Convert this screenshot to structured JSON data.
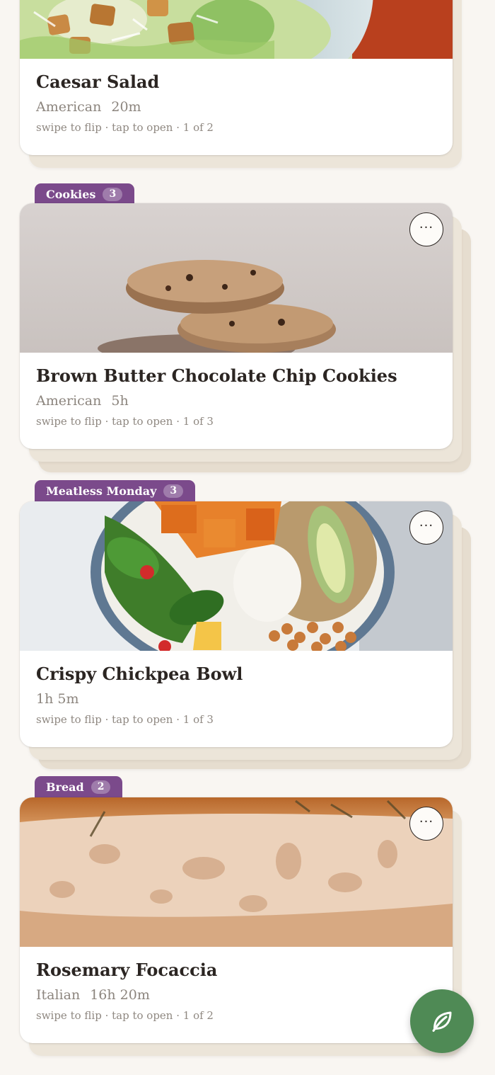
{
  "cards": [
    {
      "title": "Caesar Salad",
      "cuisine": "American",
      "time": "20m",
      "hint": "swipe to flip · tap to open · 1 of 2"
    },
    {
      "collection": "Cookies",
      "count": "3",
      "title": "Brown Butter Chocolate Chip Cookies",
      "cuisine": "American",
      "time": "5h",
      "hint": "swipe to flip · tap to open · 1 of 3",
      "more": "···"
    },
    {
      "collection": "Meatless Monday",
      "count": "3",
      "title": "Crispy Chickpea Bowl",
      "time": "1h 5m",
      "hint": "swipe to flip · tap to open · 1 of 3",
      "more": "···"
    },
    {
      "collection": "Bread",
      "count": "2",
      "title": "Rosemary Focaccia",
      "cuisine": "Italian",
      "time": "16h 20m",
      "hint": "swipe to flip · tap to open · 1 of 2",
      "more": "···"
    }
  ],
  "fab": {
    "icon": "leaf-icon"
  },
  "colors": {
    "background": "#f9f6f2",
    "collection_tab": "#7b4a8b",
    "fab": "#4f8a55",
    "title_text": "#2b2522",
    "meta_text": "#8c857e"
  }
}
